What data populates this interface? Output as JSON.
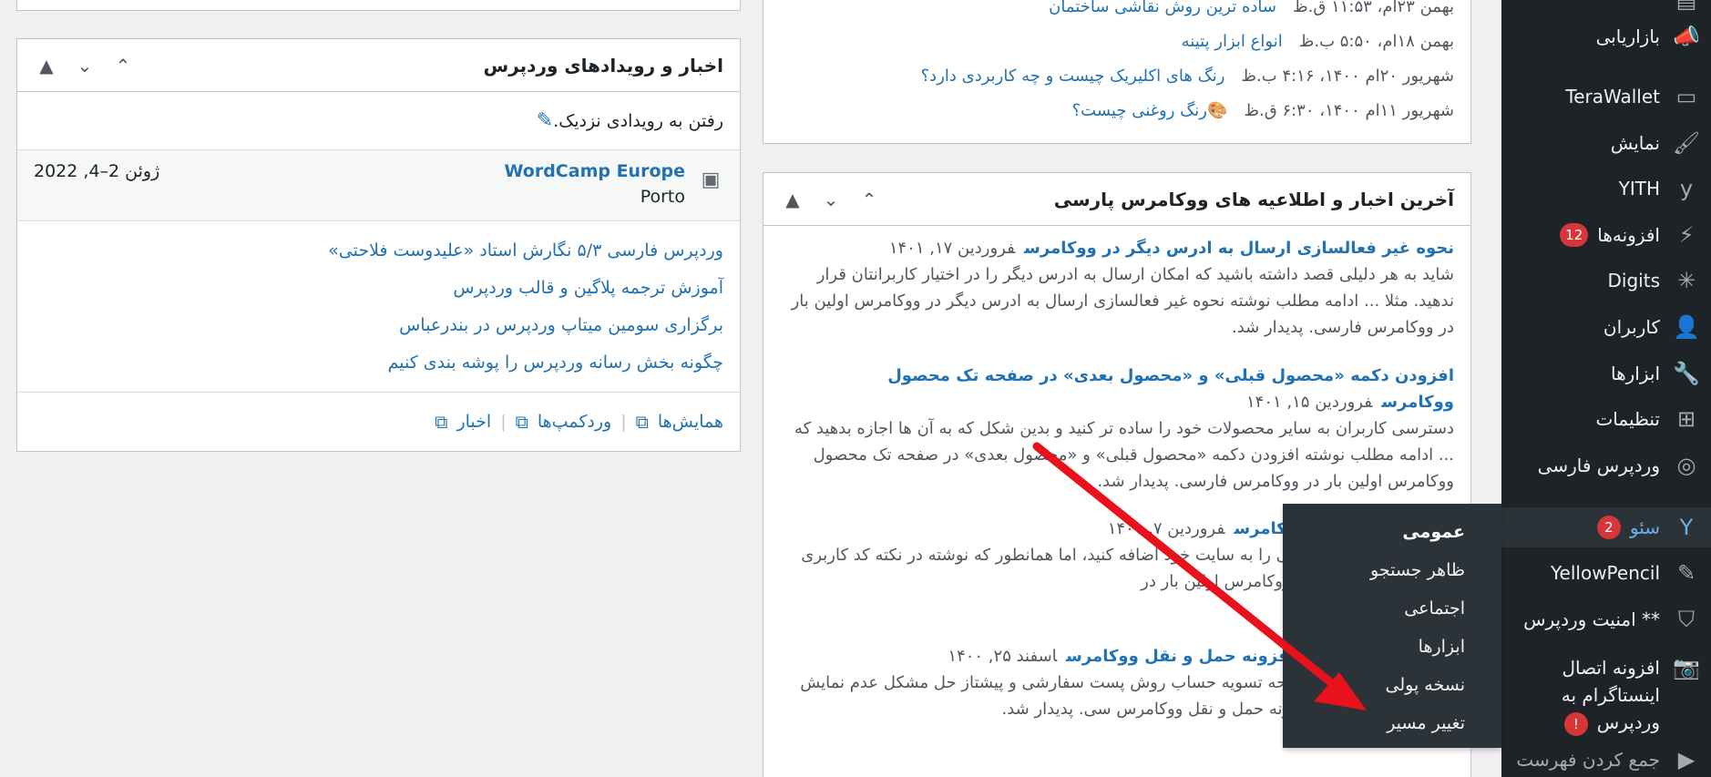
{
  "sidebar": {
    "items": [
      {
        "label": "",
        "icon": "menu-icon"
      },
      {
        "label": "بازاریابی",
        "icon": "megaphone-icon"
      },
      {
        "label": "TeraWallet",
        "icon": "wallet-icon"
      },
      {
        "label": "نمایش",
        "icon": "paintbrush-icon"
      },
      {
        "label": "YITH",
        "icon": "yith-icon"
      },
      {
        "label": "افزونه‌ها",
        "icon": "plugins-icon",
        "badge": "12"
      },
      {
        "label": "Digits",
        "icon": "digits-icon"
      },
      {
        "label": "کاربران",
        "icon": "users-icon"
      },
      {
        "label": "ابزارها",
        "icon": "wrench-icon"
      },
      {
        "label": "تنظیمات",
        "icon": "settings-icon"
      },
      {
        "label": "وردپرس فارسی",
        "icon": "wp-parsi-icon"
      },
      {
        "label": "سئو",
        "icon": "yoast-icon",
        "badge": "2"
      },
      {
        "label": "YellowPencil",
        "icon": "pencil-icon"
      },
      {
        "label": "** امنیت وردپرس",
        "icon": "shield-icon"
      },
      {
        "label": "افزونه اتصال اینستاگرام به وردپرس",
        "icon": "camera-icon",
        "badge": "!"
      },
      {
        "label": "جمع کردن فهرست",
        "icon": "collapse-icon"
      }
    ]
  },
  "flyout": {
    "items": [
      "عمومی",
      "ظاهر جستجو",
      "اجتماعی",
      "ابزارها",
      "نسخه پولی",
      "تغییر مسیر"
    ]
  },
  "recent_posts": [
    {
      "date": "بهمن ۲۳ام، ۱۱:۵۳ ق.ظ",
      "title": "ساده ترین روش نقاشی ساختمان"
    },
    {
      "date": "بهمن ۱۸ام، ۵:۵۰ ب.ظ",
      "title": "انواع ابزار پتینه"
    },
    {
      "date": "شهریور ۲۰ام ۱۴۰۰، ۴:۱۶ ب.ظ",
      "title": "رنگ های اکلیریک چیست و چه کاربردی دارد؟"
    },
    {
      "date": "شهریور ۱۱ام ۱۴۰۰، ۶:۳۰ ق.ظ",
      "title": "رنگ روغنی چیست؟",
      "emoji": "🎨"
    }
  ],
  "woo_box": {
    "title": "آخرین اخبار و اطلاعیه های ووکامرس پارسی",
    "items": [
      {
        "title": "نحوه غیر فعالسازی ارسال به ادرس دیگر در ووکامرس",
        "date": "فروردین ۱۷, ۱۴۰۱",
        "excerpt": "شاید به هر دلیلی قصد داشته باشید که امکان ارسال به ادرس دیگر را در اختیار کاربرانتان قرار ندهید. مثلا ... ادامه مطلب نوشته نحوه غیر فعالسازی ارسال به ادرس دیگر در ووکامرس اولین بار در ووکامرس فارسی. پدیدار شد."
      },
      {
        "title": "افزودن دکمه «محصول قبلی» و «محصول بعدی» در صفحه تک محصول ووکامرس",
        "date": "فروردین ۱۵, ۱۴۰۱",
        "excerpt": "دسترسی کاربران به سایر محصولات خود را ساده تر کنید و بدین شکل که به آن ها اجازه بدهید که ... ادامه مطلب نوشته افزودن دکمه «محصول قبلی» و «محصول بعدی» در صفحه تک محصول ووکامرس اولین بار در ووکامرس فارسی. پدیدار شد."
      },
      {
        "title": "توضیحات محصول ووکامرس",
        "date": "فروردین ۷, ۱۴۰۱",
        "excerpt": "ه باشید که امکانات خاصی را به سایت خود اضافه کنید، اما همانطور که نوشته در نکته کد کاربری برای توضیحات محصول ووکامرس اولین بار در"
      },
      {
        "title": "وش حمل و نقل در افزونه حمل و نقل ووکامرس",
        "date": "اسفند ۲۵, ۱۴۰۰",
        "excerpt": "دارید؟ آیا شما هم در صفحه تسویه حساب روش پست سفارشی و پیشتاز حل مشکل عدم نمایش روش حمل و نقل در افزونه حمل و نقل ووکامرس سی. پدیدار شد."
      }
    ]
  },
  "events_box": {
    "title": "اخبار و رویدادهای وردپرس",
    "nearby_link": "رفتن به رویدادی نزدیک.",
    "event": {
      "title": "WordCamp Europe",
      "location": "Porto",
      "date": "ژوئن 2–4, 2022"
    },
    "news": [
      "وردپرس فارسی ۵/۳ نگارش استاد «علیدوست فلاحتی»",
      "آموزش ترجمه پلاگین و قالب وردپرس",
      "برگزاری سومین میتاپ وردپرس در بندرعباس",
      "چگونه بخش رسانه وردپرس را پوشه بندی کنیم"
    ],
    "footer": [
      "همایش‌ها",
      "وردکمپ‌ها",
      "اخبار"
    ]
  },
  "colors": {
    "sidebar": "#1d2327",
    "accent": "#2271b1",
    "badge": "#d63638",
    "arrow": "#e8111c"
  }
}
